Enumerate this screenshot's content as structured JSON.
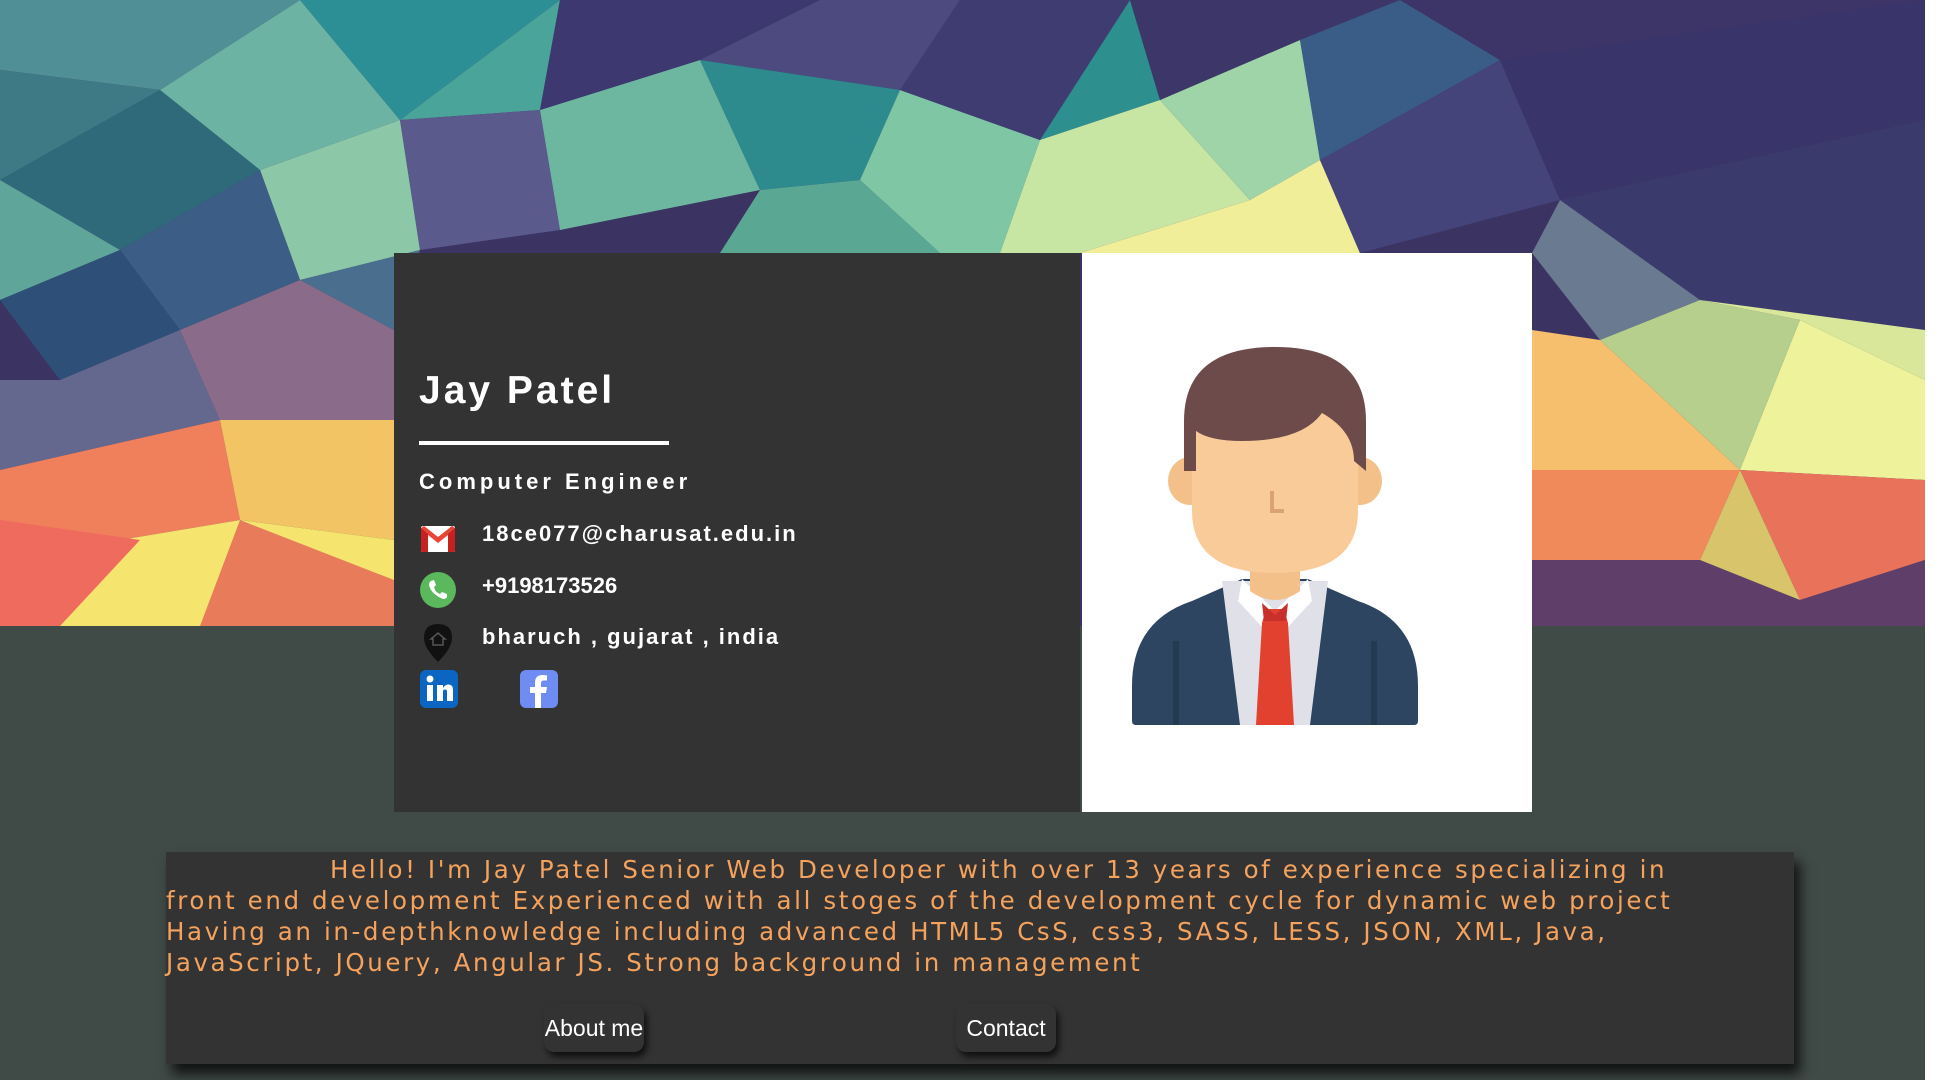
{
  "profile": {
    "name": "Jay Patel",
    "title": "Computer Engineer",
    "email": "18ce077@charusat.edu.in",
    "phone": "+9198173526",
    "location": "bharuch , gujarat , india"
  },
  "icons": {
    "email": "gmail-icon",
    "phone": "phone-icon",
    "location": "location-pin-icon",
    "linkedin": "linkedin-icon",
    "facebook": "facebook-icon",
    "avatar": "businessman-avatar"
  },
  "about": {
    "text": "Hello! I'm Jay Patel Senior Web Developer with over 13 years of experience specializing in front end development Experienced with all stoges of the development cycle for dynamic web project Having an in-depthknowledge including advanced HTML5 CsS, css3, SASS, LESS, JSON, XML, Java, JavaScript, JQuery, Angular JS. Strong background in management",
    "about_button": "About me",
    "contact_button": "Contact"
  },
  "colors": {
    "page_bg": "#404a47",
    "card_bg": "#333333",
    "bio_text": "#f5a25d",
    "white": "#ffffff"
  }
}
